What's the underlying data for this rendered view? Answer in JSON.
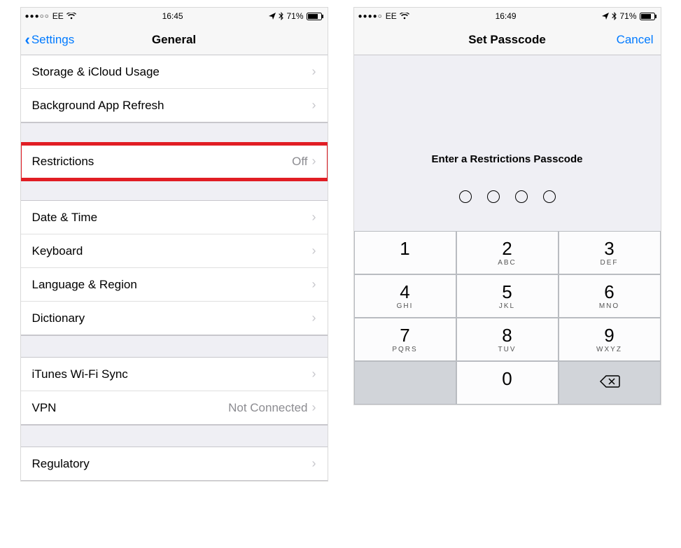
{
  "left": {
    "status": {
      "carrier": "EE",
      "time": "16:45",
      "battery": "71%"
    },
    "nav": {
      "back": "Settings",
      "title": "General"
    },
    "rows": {
      "storage": "Storage & iCloud Usage",
      "background": "Background App Refresh",
      "restrictions": "Restrictions",
      "restrictions_value": "Off",
      "datetime": "Date & Time",
      "keyboard": "Keyboard",
      "language": "Language & Region",
      "dictionary": "Dictionary",
      "itunes": "iTunes Wi-Fi Sync",
      "vpn": "VPN",
      "vpn_value": "Not Connected",
      "regulatory": "Regulatory"
    }
  },
  "right": {
    "status": {
      "carrier": "EE",
      "time": "16:49",
      "battery": "71%"
    },
    "nav": {
      "title": "Set Passcode",
      "cancel": "Cancel"
    },
    "prompt": "Enter a Restrictions Passcode",
    "keys": {
      "k1": "1",
      "k2": "2",
      "k2l": "ABC",
      "k3": "3",
      "k3l": "DEF",
      "k4": "4",
      "k4l": "GHI",
      "k5": "5",
      "k5l": "JKL",
      "k6": "6",
      "k6l": "MNO",
      "k7": "7",
      "k7l": "PQRS",
      "k8": "8",
      "k8l": "TUV",
      "k9": "9",
      "k9l": "WXYZ",
      "k0": "0"
    }
  }
}
